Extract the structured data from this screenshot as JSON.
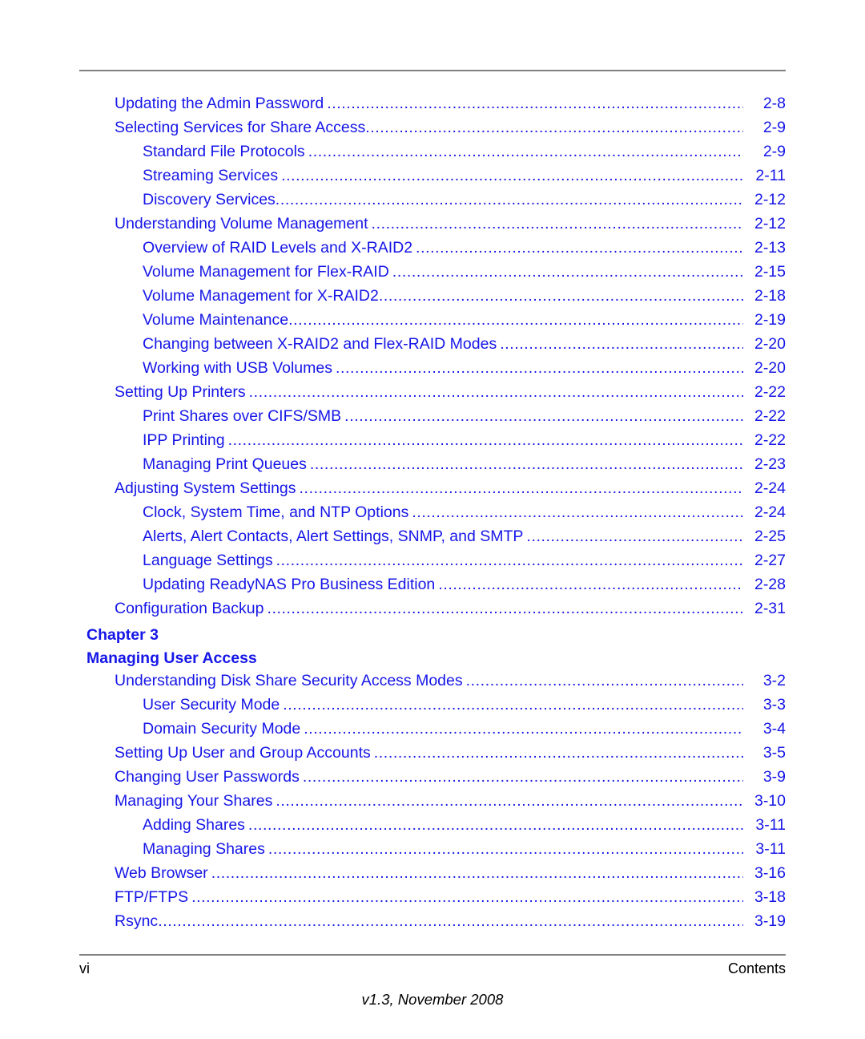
{
  "document": {
    "type": "table-of-contents",
    "text_color": "#1616e8",
    "footer_color": "#000000",
    "rule_color": "#808080"
  },
  "toc": {
    "entries": [
      {
        "level": 1,
        "title": "Updating the Admin Password",
        "gap": true,
        "page": "2-8"
      },
      {
        "level": 1,
        "title": "Selecting Services for Share Access",
        "gap": false,
        "page": "2-9"
      },
      {
        "level": 2,
        "title": "Standard File Protocols",
        "gap": true,
        "page": "2-9"
      },
      {
        "level": 2,
        "title": "Streaming Services",
        "gap": true,
        "page": "2-11"
      },
      {
        "level": 2,
        "title": "Discovery Services",
        "gap": false,
        "page": "2-12"
      },
      {
        "level": 1,
        "title": "Understanding Volume Management",
        "gap": true,
        "page": "2-12"
      },
      {
        "level": 2,
        "title": "Overview of RAID Levels and X-RAID2",
        "gap": true,
        "page": "2-13"
      },
      {
        "level": 2,
        "title": "Volume Management for Flex-RAID",
        "gap": true,
        "page": "2-15"
      },
      {
        "level": 2,
        "title": "Volume Management for X-RAID2",
        "gap": false,
        "page": "2-18"
      },
      {
        "level": 2,
        "title": "Volume Maintenance",
        "gap": false,
        "page": "2-19"
      },
      {
        "level": 2,
        "title": "Changing between X-RAID2 and Flex-RAID Modes",
        "gap": true,
        "page": "2-20"
      },
      {
        "level": 2,
        "title": "Working with USB Volumes",
        "gap": true,
        "page": "2-20"
      },
      {
        "level": 1,
        "title": "Setting Up Printers",
        "gap": true,
        "page": "2-22"
      },
      {
        "level": 2,
        "title": "Print Shares over CIFS/SMB",
        "gap": true,
        "page": "2-22"
      },
      {
        "level": 2,
        "title": "IPP Printing",
        "gap": true,
        "page": "2-22"
      },
      {
        "level": 2,
        "title": "Managing Print Queues",
        "gap": true,
        "page": "2-23"
      },
      {
        "level": 1,
        "title": "Adjusting System Settings",
        "gap": true,
        "page": "2-24"
      },
      {
        "level": 2,
        "title": "Clock, System Time, and NTP Options",
        "gap": true,
        "page": "2-24"
      },
      {
        "level": 2,
        "title": "Alerts, Alert Contacts, Alert Settings, SNMP, and SMTP",
        "gap": true,
        "page": "2-25"
      },
      {
        "level": 2,
        "title": "Language Settings",
        "gap": true,
        "page": "2-27"
      },
      {
        "level": 2,
        "title": "Updating ReadyNAS Pro Business Edition",
        "gap": true,
        "page": "2-28"
      },
      {
        "level": 1,
        "title": "Configuration Backup",
        "gap": true,
        "page": "2-31"
      }
    ],
    "chapter": {
      "label": "Chapter",
      "number": "3",
      "title": "Managing User Access"
    },
    "entries_after_chapter": [
      {
        "level": 1,
        "title": "Understanding Disk Share Security Access Modes",
        "gap": true,
        "page": "3-2"
      },
      {
        "level": 2,
        "title": "User Security Mode",
        "gap": true,
        "page": "3-3"
      },
      {
        "level": 2,
        "title": "Domain Security Mode",
        "gap": true,
        "page": "3-4"
      },
      {
        "level": 1,
        "title": "Setting Up User and Group Accounts",
        "gap": true,
        "page": "3-5"
      },
      {
        "level": 1,
        "title": "Changing User Passwords",
        "gap": true,
        "page": "3-9"
      },
      {
        "level": 1,
        "title": "Managing Your Shares",
        "gap": true,
        "page": "3-10"
      },
      {
        "level": 2,
        "title": "Adding Shares",
        "gap": true,
        "page": "3-11"
      },
      {
        "level": 2,
        "title": "Managing Shares",
        "gap": true,
        "page": "3-11"
      },
      {
        "level": 1,
        "title": "Web Browser",
        "gap": true,
        "page": "3-16"
      },
      {
        "level": 1,
        "title": "FTP/FTPS",
        "gap": true,
        "page": "3-18"
      },
      {
        "level": 1,
        "title": "Rsync",
        "gap": false,
        "page": "3-19"
      }
    ]
  },
  "footer": {
    "page_number": "vi",
    "section_label": "Contents",
    "version_line": "v1.3, November 2008"
  }
}
